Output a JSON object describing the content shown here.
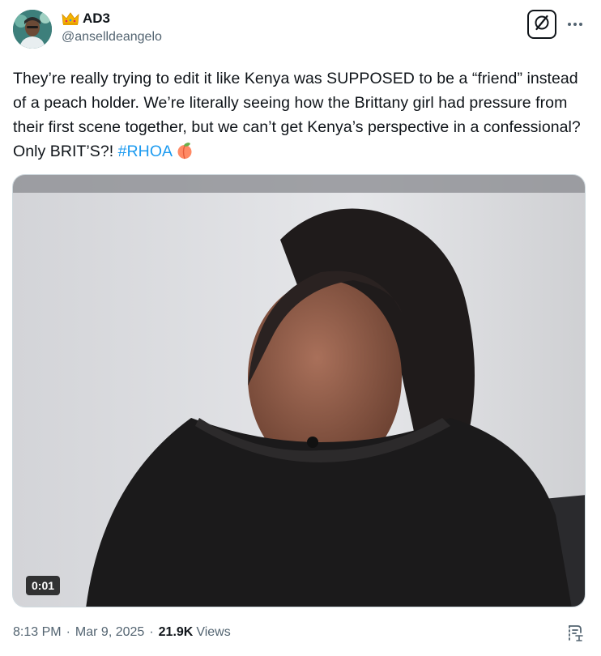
{
  "author": {
    "display_name": "AD3",
    "handle": "@anselldeangelo",
    "badge_icon": "crown-emoji"
  },
  "actions": {
    "grok_icon": "grok-icon",
    "more_icon": "more-horizontal-icon"
  },
  "tweet": {
    "text_before": "They’re really trying to edit it like Kenya was SUPPOSED to be a “friend” instead of a peach holder. We’re literally seeing how the Brittany girl had pressure from their first scene together, but we can’t get Kenya’s perspective in a confessional? Only BRIT’S?! ",
    "hashtag": "#RHOA",
    "emoji": "peach-emoji"
  },
  "media": {
    "type": "video",
    "duration": "0:01"
  },
  "meta": {
    "time": "8:13 PM",
    "separator": "·",
    "date": "Mar 9, 2025",
    "views_count": "21.9K",
    "views_label": "Views"
  },
  "colors": {
    "text": "#0f1419",
    "secondary": "#536471",
    "link": "#1d9bf0"
  }
}
